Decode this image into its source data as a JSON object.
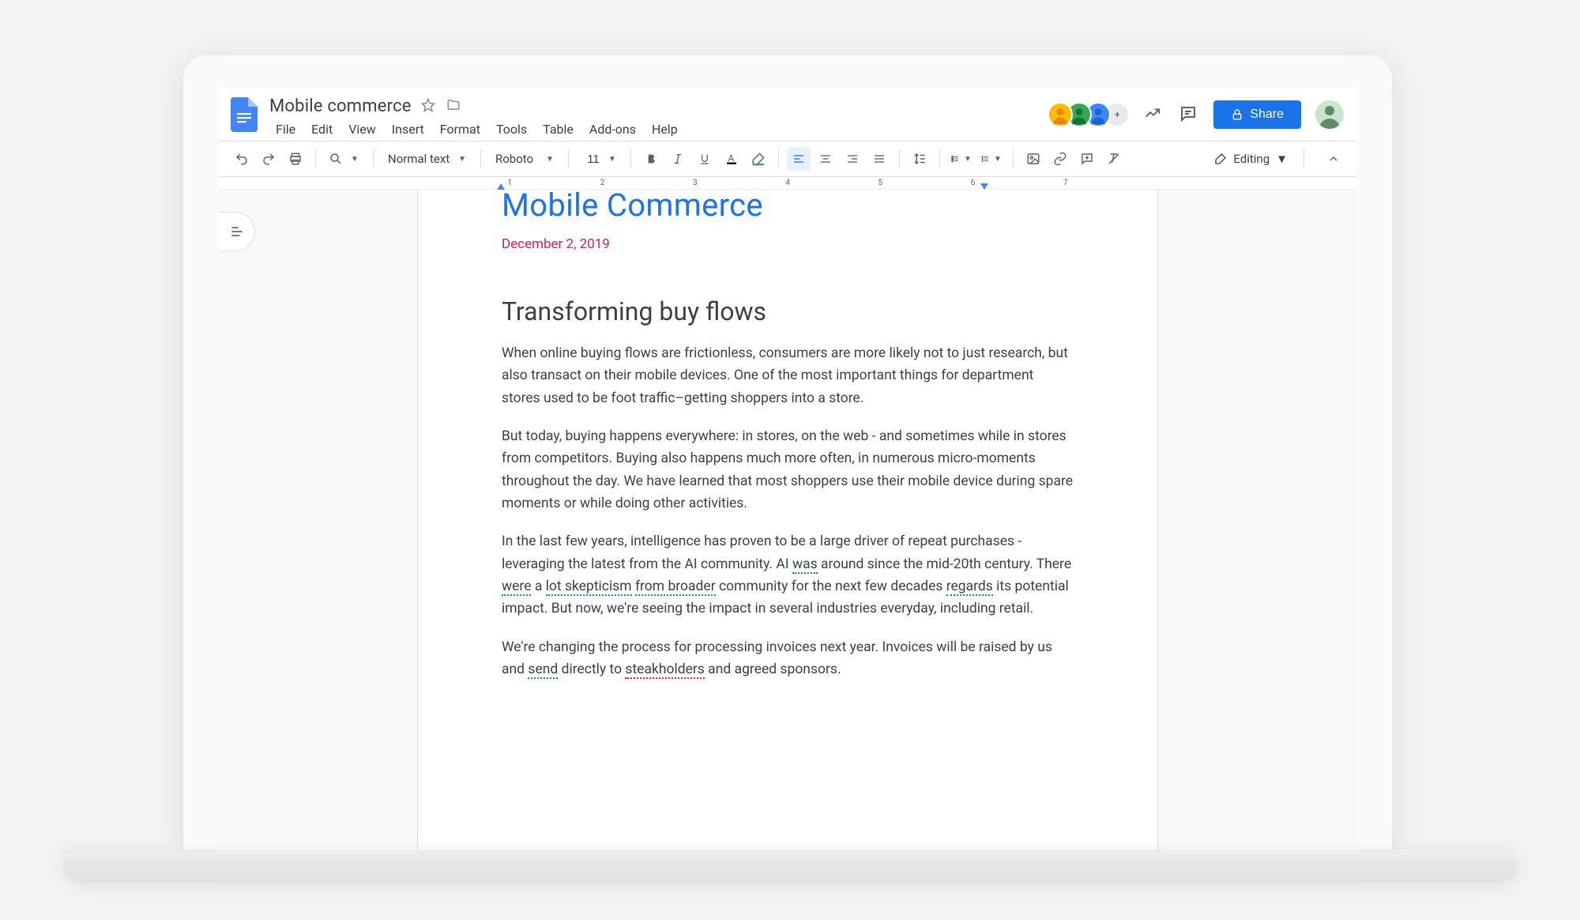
{
  "title": "Mobile commerce",
  "menus": [
    "File",
    "Edit",
    "View",
    "Insert",
    "Format",
    "Tools",
    "Table",
    "Add-ons",
    "Help"
  ],
  "avatars_more": "+",
  "share_label": "Share",
  "toolbar": {
    "style": "Normal text",
    "font": "Roboto",
    "size": "11",
    "mode": "Editing"
  },
  "ruler_numbers": [
    "1",
    "2",
    "3",
    "4",
    "5",
    "6",
    "7"
  ],
  "document": {
    "heading": "Mobile Commerce",
    "date": "December 2, 2019",
    "h2": "Transforming buy flows",
    "p1": "When online buying flows are frictionless, consumers are more likely not to  just research, but also transact on their mobile devices. One of the most important things for department stores used to be foot traffic–getting shoppers into a store.",
    "p2": "But today, buying happens everywhere: in stores, on the web - and sometimes while in stores from competitors. Buying also happens much more often, in numerous micro-moments throughout the day. We have learned that most shoppers use their mobile device during spare moments or while doing other activities.",
    "p3_1": "In the last few years, intelligence has proven to be a large driver of repeat purchases - leveraging the latest from the AI community. AI ",
    "p3_was": "was",
    "p3_2": " around since the mid-20th century. There ",
    "p3_were": "were",
    "p3_3": " a ",
    "p3_lot": "lot skepticism",
    "p3_4": " ",
    "p3_from": "from broader",
    "p3_5": " community for the next few decades ",
    "p3_regards": "regards",
    "p3_6": " its potential impact. But now, we're seeing the impact in several industries everyday, including retail.",
    "p4_1": "We're changing the process for processing invoices next year. Invoices will be raised by us and ",
    "p4_send": "send",
    "p4_2": " directly to ",
    "p4_steak": "steakholders",
    "p4_3": " and agreed sponsors."
  }
}
